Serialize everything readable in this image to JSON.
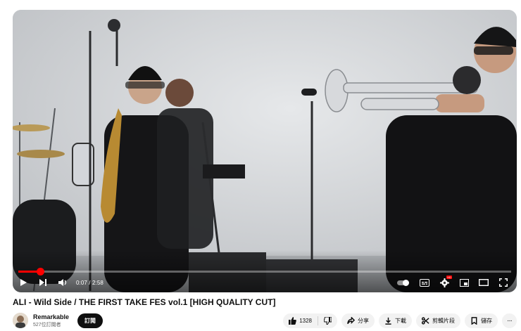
{
  "player": {
    "current_time": "0:07",
    "duration": "2:58",
    "progress_fraction": 0.044
  },
  "video": {
    "title": "ALI - Wild Side / THE FIRST TAKE FES vol.1 [HIGH QUALITY CUT]"
  },
  "channel": {
    "name": "Remarkable",
    "subscribers": "527位訂閱者",
    "subscribe_label": "訂閱"
  },
  "actions": {
    "like_count": "1328",
    "share_label": "分享",
    "download_label": "下載",
    "clip_label": "剪輯片段",
    "save_label": "儲存",
    "more_label": "···"
  },
  "colors": {
    "accent": "#ff0000",
    "subscribe_bg": "#0f0f0f",
    "pill_bg": "#f2f2f2"
  }
}
